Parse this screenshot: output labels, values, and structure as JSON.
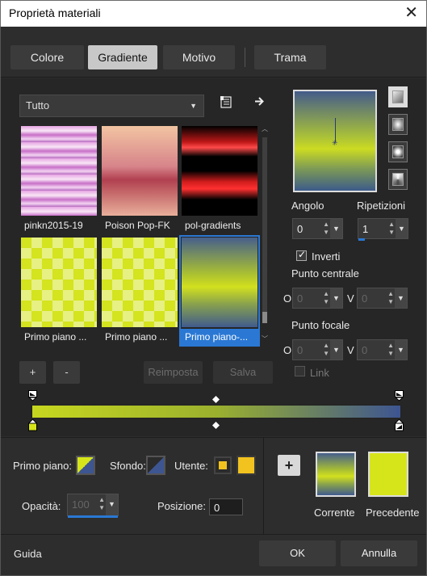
{
  "window": {
    "title": "Proprietà materiali",
    "close_glyph": "✕"
  },
  "tabs": [
    {
      "label": "Colore"
    },
    {
      "label": "Gradiente"
    },
    {
      "label": "Motivo"
    },
    {
      "label": "Trama"
    }
  ],
  "category": {
    "selected": "Tutto"
  },
  "gradients": [
    {
      "name": "pinkn2015-19"
    },
    {
      "name": "Poison Pop-FK"
    },
    {
      "name": "pol-gradients"
    },
    {
      "name": "Primo piano ..."
    },
    {
      "name": "Primo piano ..."
    },
    {
      "name": "Primo piano-..."
    }
  ],
  "list_buttons": {
    "add": "+",
    "remove": "-",
    "reset": "Reimposta",
    "save": "Salva"
  },
  "settings": {
    "angle_label": "Angolo",
    "angle_value": "0",
    "repeat_label": "Ripetizioni",
    "repeat_value": "1",
    "invert_label": "Inverti",
    "invert_checked": true,
    "center_label": "Punto centrale",
    "center_o_label": "O",
    "center_o": "0",
    "center_v_label": "V",
    "center_v": "0",
    "focal_label": "Punto focale",
    "focal_o_label": "O",
    "focal_o": "0",
    "focal_v_label": "V",
    "focal_v": "0",
    "link_label": "Link",
    "link_checked": false
  },
  "colors": {
    "foreground_label": "Primo piano:",
    "background_label": "Sfondo:",
    "user_label": "Utente:",
    "opacity_label": "Opacità:",
    "opacity_value": "100",
    "position_label": "Posizione:",
    "position_value": "0",
    "accent": "#2a78d4",
    "yellow": "#d6e51a",
    "navy": "#3d5591",
    "user_color": "#f2c31f"
  },
  "preview": {
    "add_glyph": "+",
    "current_label": "Corrente",
    "previous_label": "Precedente"
  },
  "footer": {
    "help": "Guida",
    "ok": "OK",
    "cancel": "Annulla"
  }
}
